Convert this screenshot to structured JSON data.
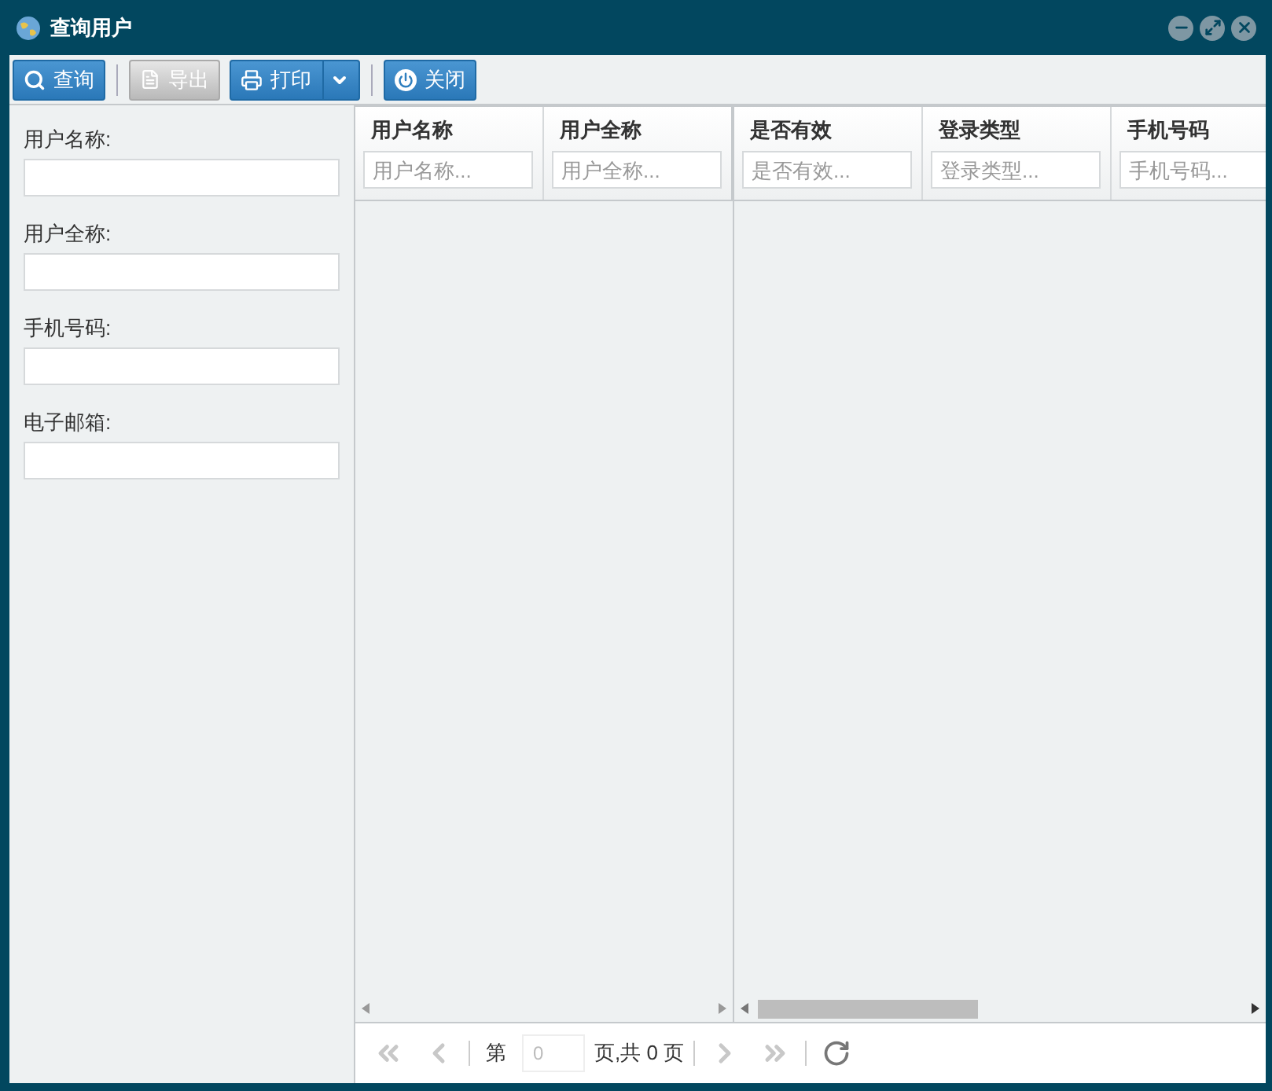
{
  "window": {
    "title": "查询用户"
  },
  "toolbar": [
    {
      "kind": "search",
      "label": "查询",
      "disabled": false
    },
    {
      "kind": "export",
      "label": "导出",
      "disabled": true
    },
    {
      "kind": "print",
      "label": "打印",
      "disabled": false
    },
    {
      "kind": "close",
      "label": "关闭",
      "disabled": false
    }
  ],
  "filters": [
    {
      "label": "用户名称:"
    },
    {
      "label": "用户全称:"
    },
    {
      "label": "手机号码:"
    },
    {
      "label": "电子邮箱:"
    }
  ],
  "table": {
    "frozen_columns": [
      {
        "title": "用户名称",
        "placeholder": "用户名称..."
      },
      {
        "title": "用户全称",
        "placeholder": "用户全称..."
      }
    ],
    "columns": [
      {
        "title": "是否有效",
        "placeholder": "是否有效..."
      },
      {
        "title": "登录类型",
        "placeholder": "登录类型..."
      },
      {
        "title": "手机号码",
        "placeholder": "手机号码..."
      }
    ]
  },
  "pager": {
    "prefix": "第",
    "page": "0",
    "suffix": "页,共 0 页",
    "first_disabled": true,
    "prev_disabled": true,
    "next_disabled": true,
    "last_disabled": true
  }
}
